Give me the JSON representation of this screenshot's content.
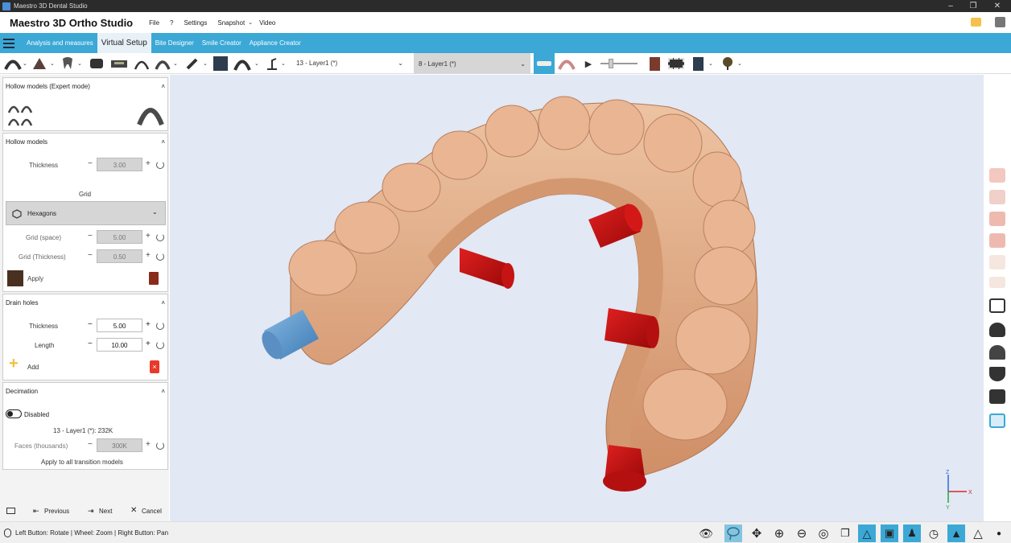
{
  "window": {
    "title": "Maestro 3D Dental Studio"
  },
  "menubar": {
    "app_title": "Maestro 3D Ortho Studio",
    "items": [
      "File",
      "?",
      "Settings",
      "Snapshot",
      "Video"
    ]
  },
  "tabs": [
    {
      "label": "Analysis and measures",
      "active": false
    },
    {
      "label": "Virtual Setup",
      "active": true
    },
    {
      "label": "Bite Designer",
      "active": false
    },
    {
      "label": "Smile Creator",
      "active": false
    },
    {
      "label": "Appliance Creator",
      "active": false
    }
  ],
  "toolbar": {
    "layer_select_1": "13 - Layer1 (*)",
    "layer_select_2": "8 - Layer1 (*)"
  },
  "panel": {
    "hollow_expert": {
      "title": "Hollow models (Expert mode)"
    },
    "hollow": {
      "title": "Hollow models",
      "thickness_label": "Thickness",
      "thickness_value": "3.00",
      "grid_heading": "Grid",
      "grid_type": "Hexagons",
      "grid_space_label": "Grid (space)",
      "grid_space_value": "5.00",
      "grid_thickness_label": "Grid (Thickness)",
      "grid_thickness_value": "0.50",
      "apply_label": "Apply"
    },
    "drain": {
      "title": "Drain holes",
      "thickness_label": "Thickness",
      "thickness_value": "5.00",
      "length_label": "Length",
      "length_value": "10.00",
      "add_label": "Add"
    },
    "decimation": {
      "title": "Decimation",
      "toggle_label": "Disabled",
      "layer_info": "13 - Layer1 (*): 232K",
      "faces_label": "Faces (thousands)",
      "faces_value": "300K",
      "apply_all": "Apply to all transition models"
    },
    "nav": {
      "previous": "Previous",
      "next": "Next",
      "cancel": "Cancel"
    }
  },
  "status": {
    "hint": "Left Button: Rotate | Wheel: Zoom | Right Button: Pan"
  },
  "axis": {
    "x": "X",
    "y": "Y",
    "z": "Z"
  },
  "colors": {
    "accent": "#3ba8d6",
    "model": "#e0a47e",
    "drain_hole": "#cc1010",
    "drain_hole_selected": "#5b9ad0",
    "viewport_bg": "#e2e8f4"
  }
}
